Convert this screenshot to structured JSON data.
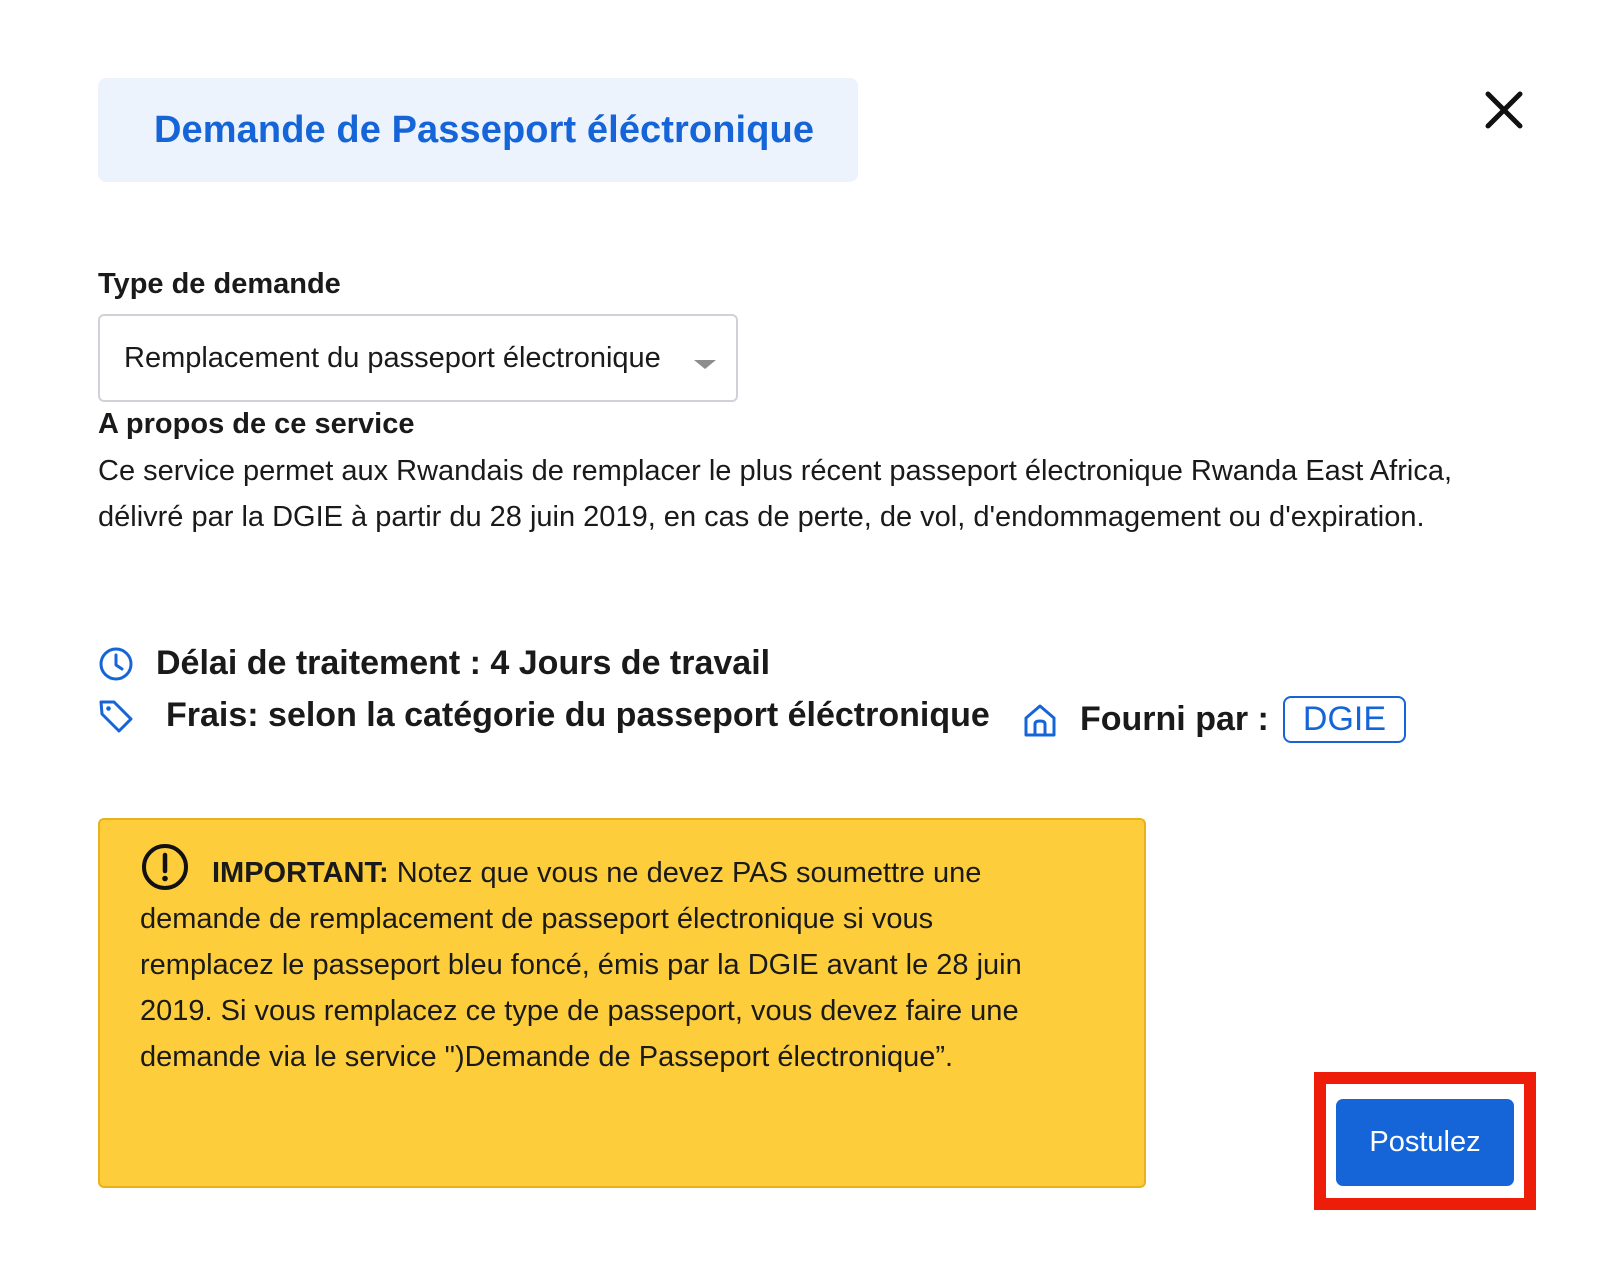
{
  "dialog": {
    "title": "Demande de Passeport éléctronique"
  },
  "form": {
    "type_label": "Type de demande",
    "type_value": "Remplacement du passeport électronique"
  },
  "about": {
    "heading": "A propos de ce service",
    "body": "Ce service permet aux Rwandais de remplacer le plus récent passeport électronique Rwanda East Africa, délivré par la DGIE à partir du 28 juin 2019, en cas de perte, de vol, d'endommagement ou d'expiration."
  },
  "details": {
    "processing": "Délai de traitement : 4 Jours de travail",
    "fees": "Frais: selon la catégorie du passeport éléctronique",
    "provider_label": "Fourni par :",
    "provider": "DGIE"
  },
  "notice": {
    "label": "IMPORTANT:",
    "text": " Notez que vous ne devez PAS soumettre une demande de remplacement de passeport électronique si vous remplacez le passeport bleu foncé, émis par la DGIE avant le 28 juin 2019. Si vous remplacez ce type de passeport, vous devez faire une demande via le service \")Demande de Passeport électronique”."
  },
  "actions": {
    "apply_label": "Postulez"
  },
  "icons": {
    "close": "close-icon",
    "select_caret": "chevron-down-icon",
    "processing": "clock-icon",
    "fees": "tag-icon",
    "provider": "home-icon",
    "warning": "exclamation-circle-icon"
  },
  "colors": {
    "accent": "#1565d8",
    "title_background": "#edf3fd",
    "warning_background": "#fdcd3b",
    "highlight_frame": "#ee1d0a"
  }
}
